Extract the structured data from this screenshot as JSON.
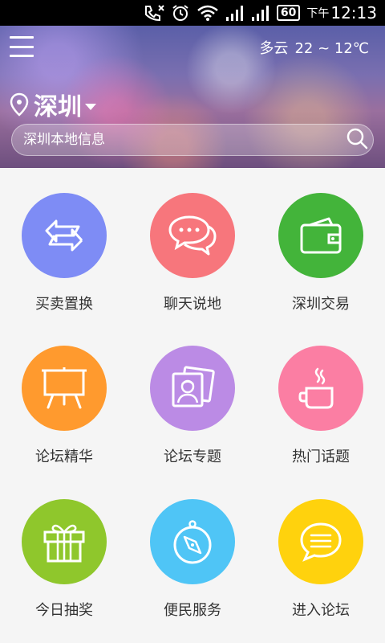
{
  "status_bar": {
    "battery": "60",
    "ampm": "下午",
    "time": "12:13"
  },
  "header": {
    "weather_condition": "多云",
    "weather_temp": "22 ~ 12℃",
    "city": "深圳",
    "search_placeholder": "深圳本地信息"
  },
  "grid": [
    {
      "label": "买卖置换",
      "color": "#7e8cf5",
      "icon": "swap-arrows-icon"
    },
    {
      "label": "聊天说地",
      "color": "#f7767c",
      "icon": "chat-bubbles-icon"
    },
    {
      "label": "深圳交易",
      "color": "#43b43a",
      "icon": "wallet-icon"
    },
    {
      "label": "论坛精华",
      "color": "#ff9a2e",
      "icon": "easel-icon"
    },
    {
      "label": "论坛专题",
      "color": "#bb8be5",
      "icon": "photo-portrait-icon"
    },
    {
      "label": "热门话题",
      "color": "#fb7ea3",
      "icon": "coffee-cup-icon"
    },
    {
      "label": "今日抽奖",
      "color": "#8fc72c",
      "icon": "gift-icon"
    },
    {
      "label": "便民服务",
      "color": "#4fc5f6",
      "icon": "compass-icon"
    },
    {
      "label": "进入论坛",
      "color": "#ffd20d",
      "icon": "message-icon"
    }
  ]
}
